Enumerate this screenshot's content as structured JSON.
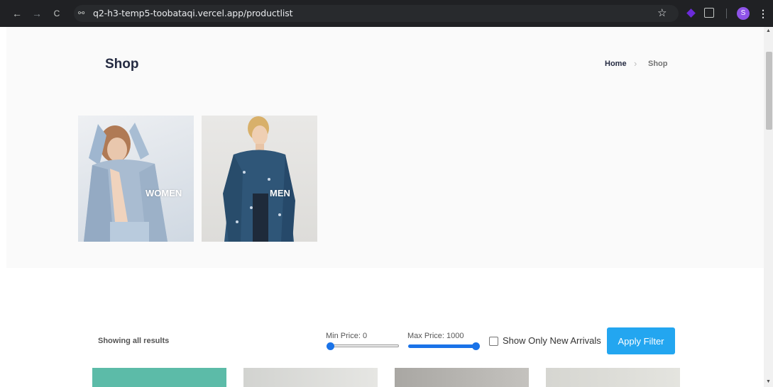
{
  "browser": {
    "url": "q2-h3-temp5-toobataqi.vercel.app/productlist",
    "back_icon": "←",
    "forward_icon": "→",
    "reload_icon": "C",
    "site_info_icon": "⚯",
    "star_icon": "☆",
    "profile_initial": "S",
    "menu_icon": "⋮"
  },
  "page": {
    "title": "Shop",
    "breadcrumb": {
      "home": "Home",
      "separator": "›",
      "current": "Shop"
    }
  },
  "categories": [
    {
      "label": "WOMEN"
    },
    {
      "label": "MEN"
    }
  ],
  "filters": {
    "results_text": "Showing all results",
    "min_price_label": "Min Price: 0",
    "max_price_label": "Max Price: 1000",
    "min_price_value": 0,
    "max_price_value": 1000,
    "new_arrivals_label": "Show Only New Arrivals",
    "new_arrivals_checked": false,
    "apply_label": "Apply Filter"
  },
  "colors": {
    "accent": "#23a6f0",
    "heading": "#252b42",
    "slider": "#1a73e8"
  }
}
